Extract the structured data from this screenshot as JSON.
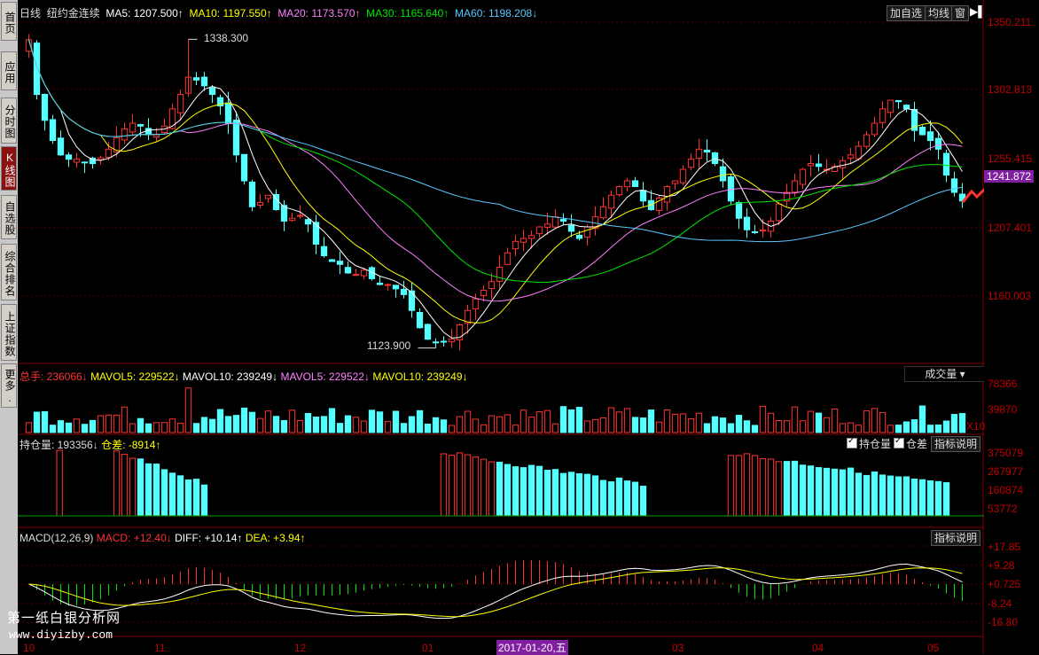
{
  "sidebar": {
    "items": [
      {
        "label": "首页",
        "active": false
      },
      {
        "label": "应用",
        "active": false
      },
      {
        "label": "分时图",
        "active": false
      },
      {
        "label": "K线图",
        "active": true
      },
      {
        "label": "自选股",
        "active": false
      },
      {
        "label": "综合排名",
        "active": false
      },
      {
        "label": "上证指数",
        "active": false
      },
      {
        "label": "更多.",
        "active": false
      }
    ]
  },
  "main_header": {
    "period": "日线",
    "name": "纽约金连续",
    "ma5": "MA5: 1207.500↑",
    "ma10": "MA10: 1197.550↑",
    "ma20": "MA20: 1173.570↑",
    "ma30": "MA30: 1165.640↑",
    "ma60": "MA60: 1198.208↓",
    "btn_add": "加自选",
    "btn_avg": "均线",
    "btn_win": "窗"
  },
  "annotations": {
    "high": "1338.300",
    "low": "1123.900",
    "current_price": "1241.872",
    "date_cursor": "2017-01-20,五"
  },
  "price_axis": [
    "1350.211",
    "1302.813",
    "1255.415",
    "1207.401",
    "1160.003"
  ],
  "volume_header": {
    "total": "总手: 236066↓",
    "mavol5": "MAVOL5: 229522↓",
    "mavol10": "MAVOL10: 239249↓",
    "mavol5b": "MAVOL5: 229522↓",
    "mavol10b": "MAVOL10: 239249↓",
    "dropdown": "成交量"
  },
  "volume_axis": [
    "78366",
    "39870",
    "X10"
  ],
  "oi_header": {
    "oi": "持仓量: 193356↓",
    "diff": "仓差: -8914↑",
    "chk1": "持仓量",
    "chk2": "仓差",
    "btn": "指标说明"
  },
  "oi_axis": [
    "375079",
    "267977",
    "160874",
    "53772"
  ],
  "macd_header": {
    "label": "MACD(12,26,9)",
    "macd": "MACD: +12.40↓",
    "diff": "DIFF: +10.14↑",
    "dea": "DEA: +3.94↑",
    "btn": "指标说明"
  },
  "macd_axis": [
    "+17.85",
    "+9.28",
    "+0.725",
    "-8.24",
    "-16.80"
  ],
  "time_axis": [
    "10",
    "11",
    "12",
    "01",
    "03",
    "04",
    "05"
  ],
  "watermark": {
    "line1": "第一纸白银分析网",
    "line2": "www.diyizby.com"
  },
  "colors": {
    "up": "#ff3232",
    "down": "#54ffff",
    "ma5": "#ffffff",
    "ma10": "#ffff00",
    "ma20": "#ff80ff",
    "ma30": "#00e600",
    "ma60": "#58c8ff",
    "axis": "#c00000"
  },
  "chart_data": {
    "type": "candlestick",
    "closes": [
      1338,
      1300,
      1282,
      1268,
      1258,
      1255,
      1255,
      1253,
      1252,
      1256,
      1262,
      1270,
      1276,
      1280,
      1278,
      1272,
      1272,
      1278,
      1290,
      1300,
      1312,
      1310,
      1306,
      1300,
      1292,
      1280,
      1258,
      1240,
      1222,
      1225,
      1230,
      1220,
      1212,
      1214,
      1216,
      1210,
      1196,
      1188,
      1184,
      1182,
      1176,
      1175,
      1178,
      1172,
      1168,
      1168,
      1165,
      1161,
      1150,
      1138,
      1130,
      1128,
      1128,
      1130,
      1140,
      1150,
      1158,
      1164,
      1170,
      1180,
      1190,
      1198,
      1200,
      1202,
      1208,
      1210,
      1215,
      1212,
      1205,
      1200,
      1208,
      1215,
      1222,
      1230,
      1236,
      1240,
      1236,
      1226,
      1220,
      1228,
      1236,
      1240,
      1248,
      1255,
      1262,
      1260,
      1252,
      1240,
      1226,
      1214,
      1206,
      1204,
      1206,
      1212,
      1224,
      1232,
      1240,
      1248,
      1252,
      1250,
      1248,
      1250,
      1254,
      1258,
      1264,
      1272,
      1280,
      1290,
      1296,
      1295,
      1290,
      1275,
      1272,
      1268,
      1262,
      1244,
      1232,
      1226
    ]
  }
}
